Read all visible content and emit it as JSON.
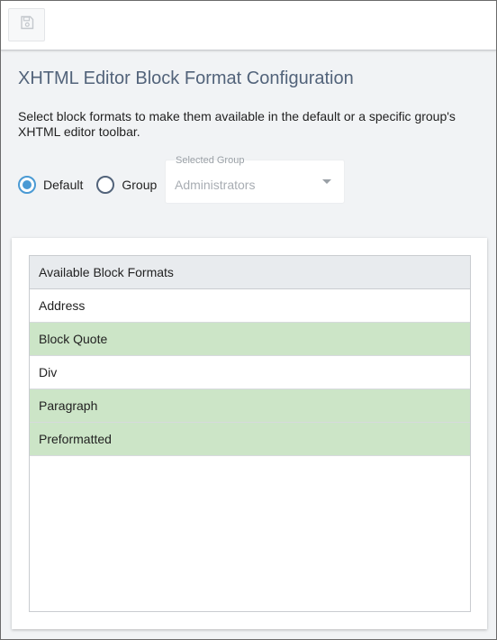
{
  "toolbar": {
    "save_icon": "save-icon"
  },
  "page": {
    "title": "XHTML Editor Block Format Configuration",
    "description": "Select block formats to make them available in the default or a specific group's XHTML editor toolbar."
  },
  "scope": {
    "default_label": "Default",
    "group_label": "Group",
    "selected": "Default"
  },
  "group_select": {
    "label": "Selected Group",
    "value": "Administrators"
  },
  "block_formats": {
    "header": "Available Block Formats",
    "items": [
      {
        "label": "Address",
        "selected": false
      },
      {
        "label": "Block Quote",
        "selected": true
      },
      {
        "label": "Div",
        "selected": false
      },
      {
        "label": "Paragraph",
        "selected": true
      },
      {
        "label": "Preformatted",
        "selected": true
      }
    ]
  },
  "colors": {
    "title": "#52637a",
    "radio_accent": "#4a9ad4",
    "selected_row": "#cce5c7"
  }
}
